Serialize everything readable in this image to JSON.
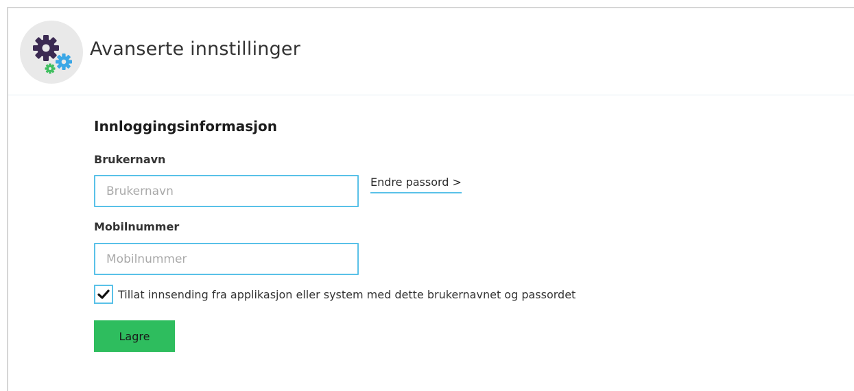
{
  "header": {
    "title": "Avanserte innstillinger",
    "icon": "gears-icon"
  },
  "form": {
    "section_title": "Innloggingsinformasjon",
    "username": {
      "label": "Brukernavn",
      "placeholder": "Brukernavn",
      "value": ""
    },
    "change_password_link": "Endre passord >",
    "mobile": {
      "label": "Mobilnummer",
      "placeholder": "Mobilnummer",
      "value": ""
    },
    "allow_submission": {
      "label": "Tillat innsending fra applikasjon eller system med dette brukernavnet og passordet",
      "checked": true
    },
    "save_label": "Lagre"
  },
  "colors": {
    "accent": "#59c1e8",
    "save_button": "#2ebd5e",
    "gear_large": "#3b2a52",
    "gear_blue": "#3ba7e6",
    "gear_green": "#3fbf5f"
  }
}
